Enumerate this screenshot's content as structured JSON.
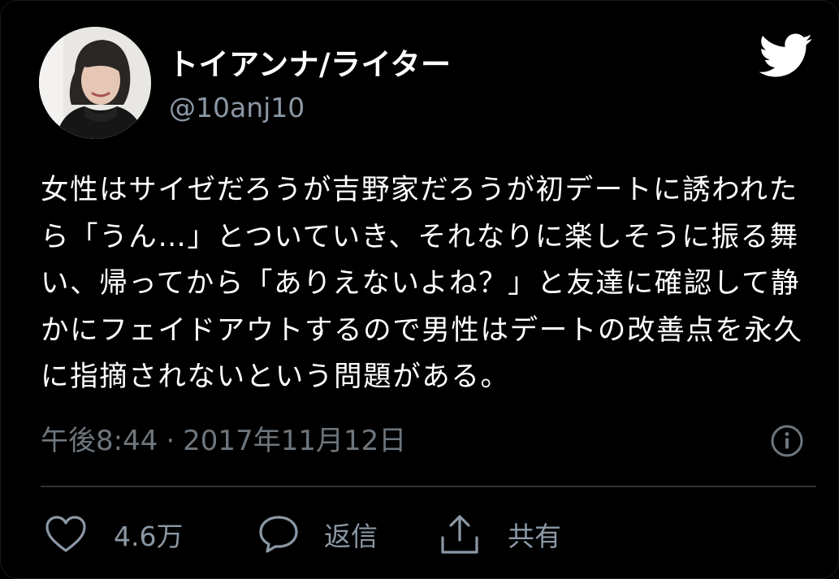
{
  "user": {
    "display_name": "トイアンナ/ライター",
    "handle": "@10anj10"
  },
  "tweet": {
    "text": "女性はサイゼだろうが吉野家だろうが初デートに誘われたら「うん…」とついていき、それなりに楽しそうに振る舞い、帰ってから「ありえないよね？」と友達に確認して静かにフェイドアウトするので男性はデートの改善点を永久に指摘されないという問題がある。",
    "time": "午後8:44",
    "separator": "·",
    "date": "2017年11月12日"
  },
  "actions": {
    "like_count": "4.6万",
    "reply_label": "返信",
    "share_label": "共有"
  },
  "icons": {
    "brand": "twitter-bird-icon",
    "info": "info-icon",
    "like": "heart-icon",
    "reply": "speech-bubble-icon",
    "share": "share-icon"
  },
  "colors": {
    "background": "#000000",
    "text_primary": "#ffffff",
    "text_secondary": "#8b98a5",
    "divider": "#2f3336"
  }
}
